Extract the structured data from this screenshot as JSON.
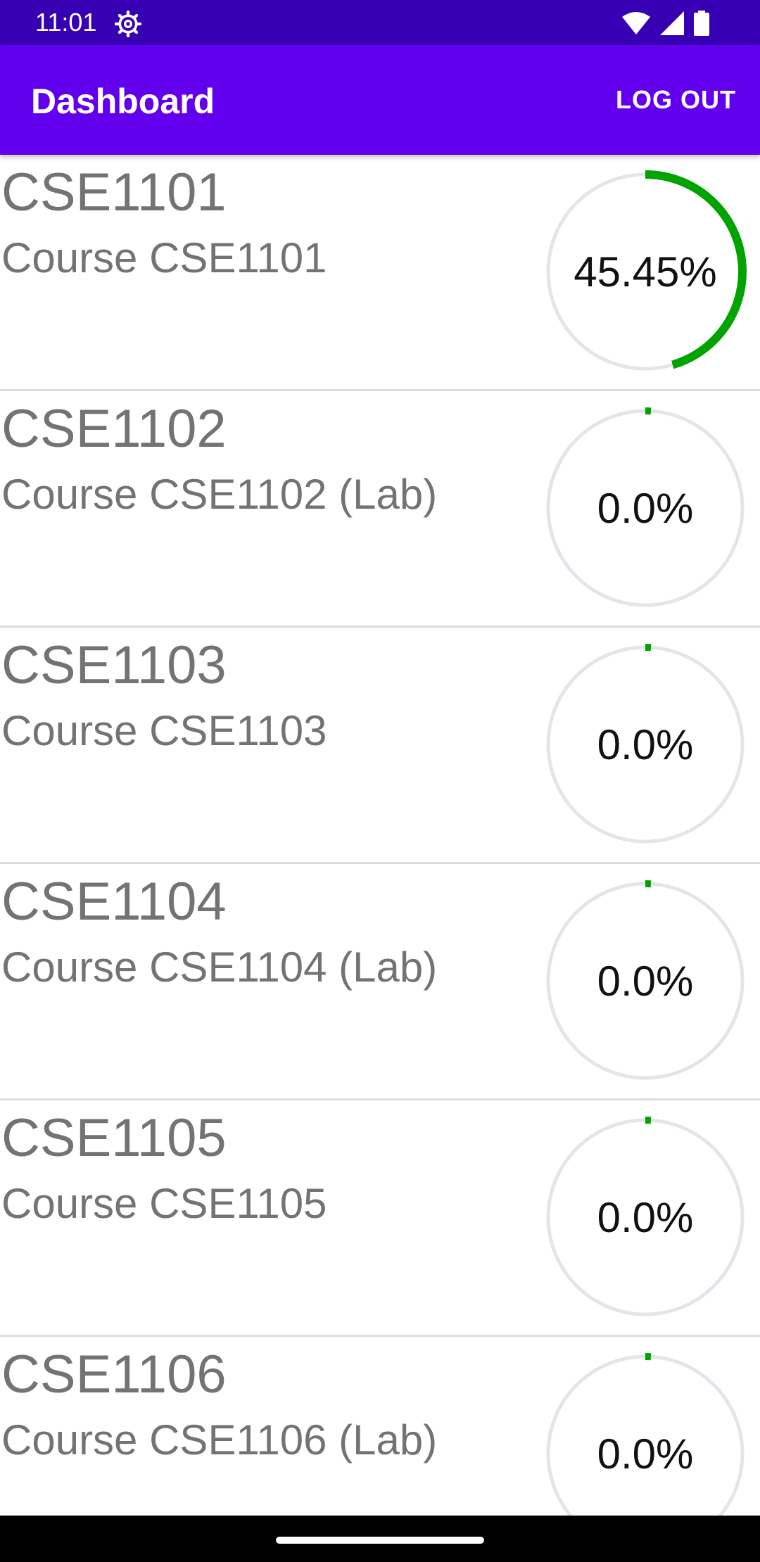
{
  "status_bar": {
    "time": "11:01",
    "icons": [
      "settings-gear-icon",
      "wifi-icon",
      "cellular-signal-icon",
      "battery-icon"
    ]
  },
  "app_bar": {
    "title": "Dashboard",
    "logout_label": "LOG OUT"
  },
  "colors": {
    "status_bar": "#3700B3",
    "app_bar": "#6200EE",
    "progress": "#00A300",
    "progress_track": "#E3E5EA",
    "course_text": "#737373"
  },
  "courses": [
    {
      "code": "CSE1101",
      "name": "Course CSE1101",
      "progress_label": "45.45%",
      "progress": 45.45
    },
    {
      "code": "CSE1102",
      "name": "Course CSE1102 (Lab)",
      "progress_label": "0.0%",
      "progress": 0.0
    },
    {
      "code": "CSE1103",
      "name": "Course CSE1103",
      "progress_label": "0.0%",
      "progress": 0.0
    },
    {
      "code": "CSE1104",
      "name": "Course CSE1104 (Lab)",
      "progress_label": "0.0%",
      "progress": 0.0
    },
    {
      "code": "CSE1105",
      "name": "Course CSE1105",
      "progress_label": "0.0%",
      "progress": 0.0
    },
    {
      "code": "CSE1106",
      "name": "Course CSE1106 (Lab)",
      "progress_label": "0.0%",
      "progress": 0.0
    }
  ]
}
